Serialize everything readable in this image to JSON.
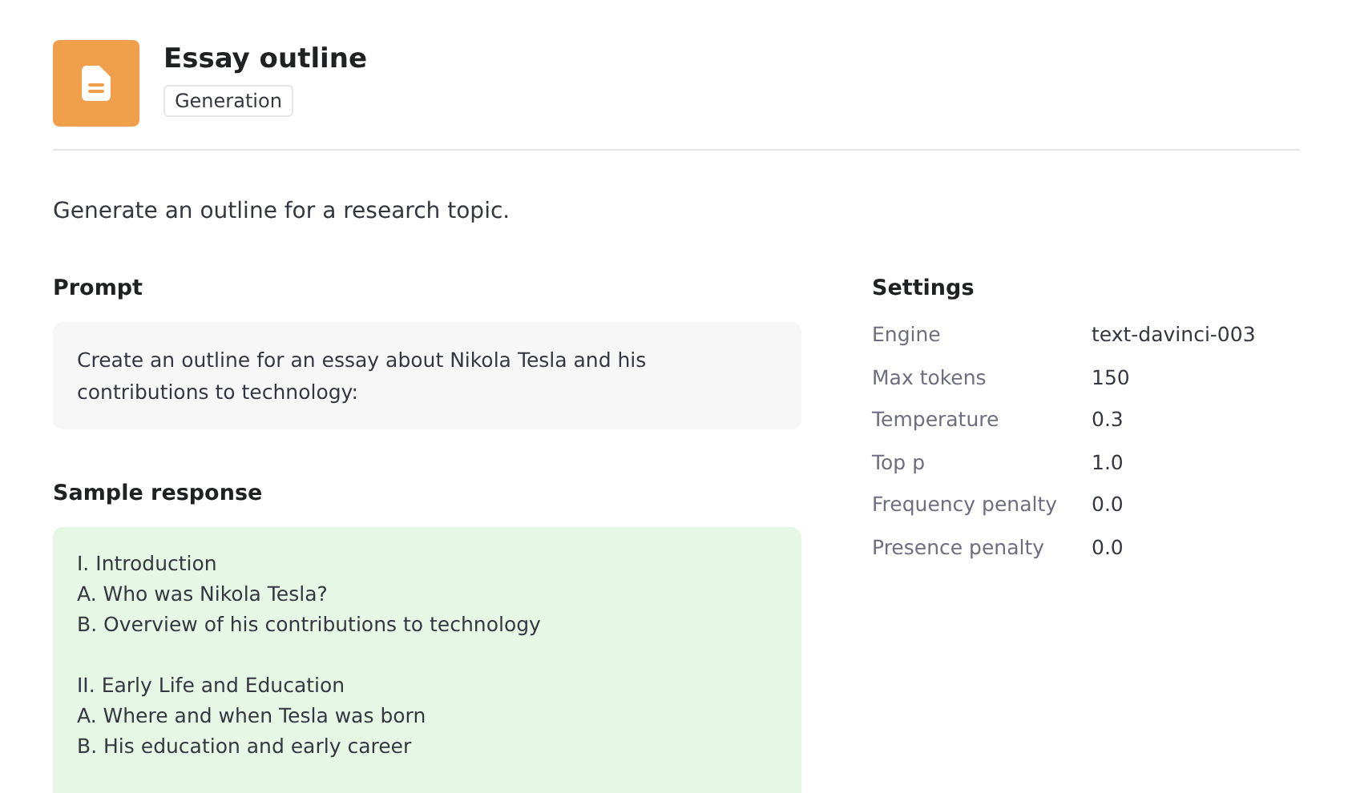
{
  "header": {
    "title": "Essay outline",
    "tag": "Generation"
  },
  "description": "Generate an outline for a research topic.",
  "prompt": {
    "heading": "Prompt",
    "text": "Create an outline for an essay about Nikola Tesla and his contributions to technology:"
  },
  "sample_response": {
    "heading": "Sample response",
    "groups": [
      [
        "I. Introduction",
        "A. Who was Nikola Tesla?",
        "B. Overview of his contributions to technology"
      ],
      [
        "II. Early Life and Education",
        "A. Where and when Tesla was born",
        "B. His education and early career"
      ]
    ]
  },
  "settings": {
    "heading": "Settings",
    "rows": [
      {
        "label": "Engine",
        "value": "text-davinci-003"
      },
      {
        "label": "Max tokens",
        "value": "150"
      },
      {
        "label": "Temperature",
        "value": "0.3"
      },
      {
        "label": "Top p",
        "value": "1.0"
      },
      {
        "label": "Frequency penalty",
        "value": "0.0"
      },
      {
        "label": "Presence penalty",
        "value": "0.0"
      }
    ]
  }
}
